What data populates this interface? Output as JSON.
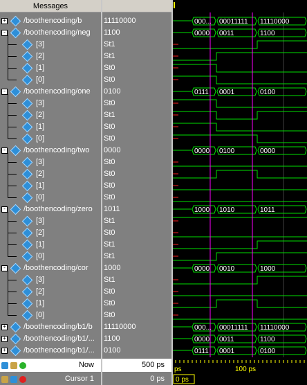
{
  "header": {
    "names_title": "Messages"
  },
  "rows": [
    {
      "kind": "bus",
      "name": "/boothencoding/b",
      "value": "11110000",
      "expand": "+"
    },
    {
      "kind": "bus",
      "name": "/boothencoding/neg",
      "value": "1100",
      "expand": "-"
    },
    {
      "kind": "bit",
      "name": "[3]",
      "value": "St1"
    },
    {
      "kind": "bit",
      "name": "[2]",
      "value": "St1"
    },
    {
      "kind": "bit",
      "name": "[1]",
      "value": "St0"
    },
    {
      "kind": "bit",
      "name": "[0]",
      "value": "St0"
    },
    {
      "kind": "bus",
      "name": "/boothencoding/one",
      "value": "0100",
      "expand": "-"
    },
    {
      "kind": "bit",
      "name": "[3]",
      "value": "St0"
    },
    {
      "kind": "bit",
      "name": "[2]",
      "value": "St1"
    },
    {
      "kind": "bit",
      "name": "[1]",
      "value": "St0"
    },
    {
      "kind": "bit",
      "name": "[0]",
      "value": "St0"
    },
    {
      "kind": "bus",
      "name": "/boothencoding/two",
      "value": "0000",
      "expand": "-"
    },
    {
      "kind": "bit",
      "name": "[3]",
      "value": "St0"
    },
    {
      "kind": "bit",
      "name": "[2]",
      "value": "St0"
    },
    {
      "kind": "bit",
      "name": "[1]",
      "value": "St0"
    },
    {
      "kind": "bit",
      "name": "[0]",
      "value": "St0"
    },
    {
      "kind": "bus",
      "name": "/boothencoding/zero",
      "value": "1011",
      "expand": "-"
    },
    {
      "kind": "bit",
      "name": "[3]",
      "value": "St1"
    },
    {
      "kind": "bit",
      "name": "[2]",
      "value": "St0"
    },
    {
      "kind": "bit",
      "name": "[1]",
      "value": "St1"
    },
    {
      "kind": "bit",
      "name": "[0]",
      "value": "St1"
    },
    {
      "kind": "bus",
      "name": "/boothencoding/cor",
      "value": "1000",
      "expand": "-"
    },
    {
      "kind": "bit",
      "name": "[3]",
      "value": "St1"
    },
    {
      "kind": "bit",
      "name": "[2]",
      "value": "St0"
    },
    {
      "kind": "bit",
      "name": "[1]",
      "value": "St0"
    },
    {
      "kind": "bit",
      "name": "[0]",
      "value": "St0"
    },
    {
      "kind": "bus",
      "name": "/boothencoding/b1/b",
      "value": "11110000",
      "expand": "+"
    },
    {
      "kind": "bus",
      "name": "/boothencoding/b1/...",
      "value": "1100",
      "expand": "+"
    },
    {
      "kind": "bus",
      "name": "/boothencoding/b1/...",
      "value": "0100",
      "expand": "+"
    }
  ],
  "bus_segments": {
    "0": [
      "000...",
      "00011111",
      "11110000"
    ],
    "1": [
      "0000",
      "0011",
      "1100"
    ],
    "6": [
      "0111",
      "0001",
      "0100"
    ],
    "11": [
      "0000",
      "0100",
      "0000"
    ],
    "16": [
      "1000",
      "1010",
      "1011"
    ],
    "21": [
      "0000",
      "0010",
      "1000"
    ],
    "26": [
      "000...",
      "00011111",
      "11110000"
    ],
    "27": [
      "0000",
      "0011",
      "1100"
    ],
    "28": [
      "0111",
      "0001",
      "0100"
    ]
  },
  "bit_levels": {
    "2": [
      0,
      0,
      1
    ],
    "3": [
      0,
      1,
      1
    ],
    "4": [
      1,
      0,
      0
    ],
    "5": [
      1,
      0,
      0
    ],
    "7": [
      1,
      0,
      0
    ],
    "8": [
      1,
      0,
      1
    ],
    "9": [
      1,
      0,
      0
    ],
    "10": [
      1,
      1,
      0
    ],
    "12": [
      0,
      0,
      0
    ],
    "13": [
      0,
      1,
      0
    ],
    "14": [
      0,
      0,
      0
    ],
    "15": [
      0,
      0,
      0
    ],
    "17": [
      1,
      1,
      1
    ],
    "18": [
      0,
      0,
      0
    ],
    "19": [
      0,
      0,
      1
    ],
    "20": [
      0,
      1,
      1
    ],
    "22": [
      0,
      0,
      1
    ],
    "23": [
      0,
      0,
      0
    ],
    "24": [
      0,
      1,
      0
    ],
    "25": [
      0,
      0,
      0
    ]
  },
  "footer": {
    "now_label": "Now",
    "now_value": "500 ps",
    "cursor_label": "Cursor 1",
    "cursor_value": "0 ps",
    "timeline_start": "ps",
    "timeline_mid": "100 ps",
    "cursor_readout": "0 ps"
  },
  "colors": {
    "wave": "#00e000",
    "bus_text": "#ffffff",
    "cursor": "#ff00ff",
    "timeline_ruler": "#ffff00",
    "cursor_box": "#ffff00"
  }
}
